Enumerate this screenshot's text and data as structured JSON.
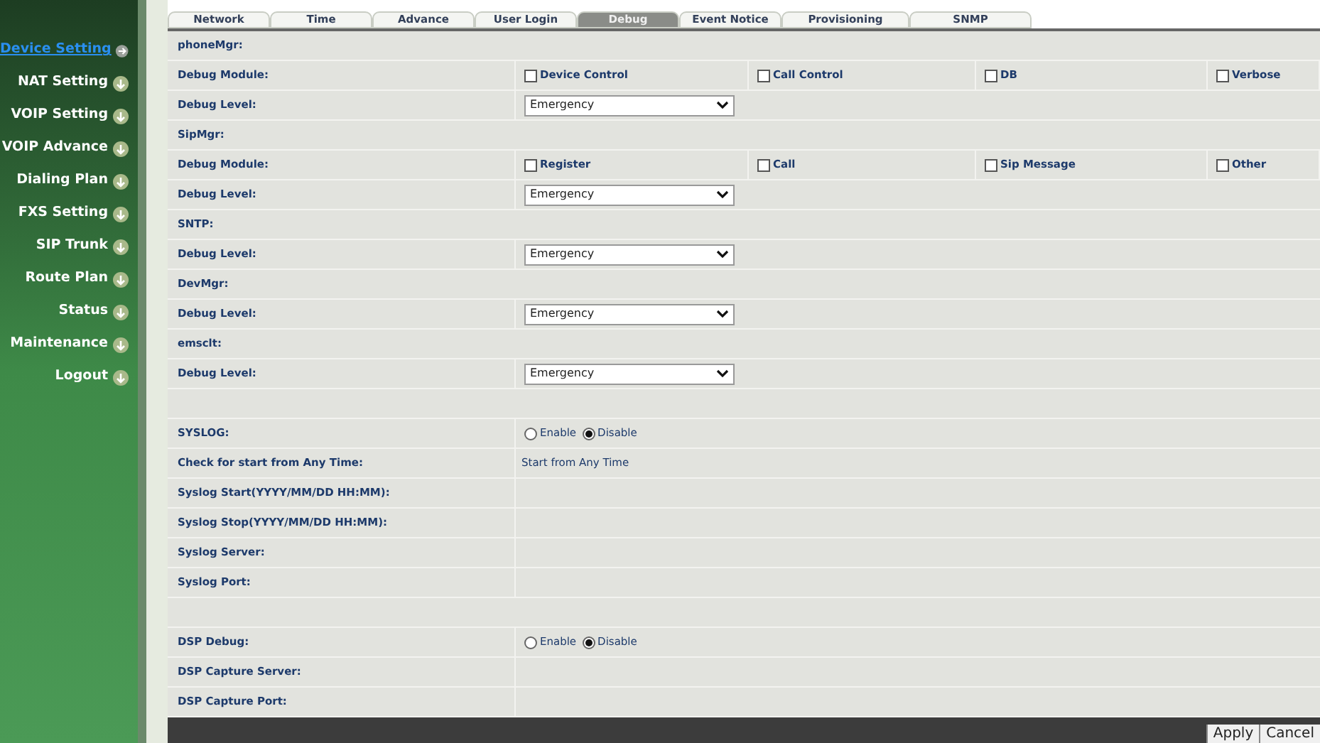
{
  "sidebar": {
    "items": [
      {
        "label": "Device Setting",
        "selected": true
      },
      {
        "label": "NAT Setting",
        "selected": false
      },
      {
        "label": "VOIP Setting",
        "selected": false
      },
      {
        "label": "VOIP Advance",
        "selected": false
      },
      {
        "label": "Dialing Plan",
        "selected": false
      },
      {
        "label": "FXS Setting",
        "selected": false
      },
      {
        "label": "SIP Trunk",
        "selected": false
      },
      {
        "label": "Route Plan",
        "selected": false
      },
      {
        "label": "Status",
        "selected": false
      },
      {
        "label": "Maintenance",
        "selected": false
      },
      {
        "label": "Logout",
        "selected": false
      }
    ]
  },
  "tabs": [
    {
      "label": "Network",
      "selected": false
    },
    {
      "label": "Time",
      "selected": false
    },
    {
      "label": "Advance",
      "selected": false
    },
    {
      "label": "User Login",
      "selected": false
    },
    {
      "label": "Debug",
      "selected": true
    },
    {
      "label": "Event Notice",
      "selected": false
    },
    {
      "label": "Provisioning",
      "selected": false
    },
    {
      "label": "SNMP",
      "selected": false
    }
  ],
  "rows": [
    {
      "kind": "heading",
      "label": "phoneMgr:"
    },
    {
      "kind": "checkboxes",
      "label": "Debug Module:",
      "options": [
        {
          "label": "Device Control",
          "checked": false
        },
        {
          "label": "Call Control",
          "checked": false
        },
        {
          "label": "DB",
          "checked": false
        },
        {
          "label": "Verbose",
          "checked": false
        }
      ]
    },
    {
      "kind": "select",
      "label": "Debug Level:",
      "value": "Emergency"
    },
    {
      "kind": "heading",
      "label": "SipMgr:"
    },
    {
      "kind": "checkboxes",
      "label": "Debug Module:",
      "options": [
        {
          "label": "Register",
          "checked": false
        },
        {
          "label": "Call",
          "checked": false
        },
        {
          "label": "Sip Message",
          "checked": false
        },
        {
          "label": "Other",
          "checked": false
        }
      ]
    },
    {
      "kind": "select",
      "label": "Debug Level:",
      "value": "Emergency"
    },
    {
      "kind": "heading",
      "label": "SNTP:"
    },
    {
      "kind": "select",
      "label": "Debug Level:",
      "value": "Emergency"
    },
    {
      "kind": "heading",
      "label": "DevMgr:"
    },
    {
      "kind": "select",
      "label": "Debug Level:",
      "value": "Emergency"
    },
    {
      "kind": "heading",
      "label": "emsclt:"
    },
    {
      "kind": "select",
      "label": "Debug Level:",
      "value": "Emergency"
    },
    {
      "kind": "spacer"
    },
    {
      "kind": "radio",
      "label": "SYSLOG:",
      "options": [
        {
          "label": "Enable",
          "selected": false
        },
        {
          "label": "Disable",
          "selected": true
        }
      ]
    },
    {
      "kind": "text",
      "label": "Check for start from Any Time:",
      "value": "Start from Any Time"
    },
    {
      "kind": "field",
      "label": "Syslog Start(YYYY/MM/DD HH:MM):"
    },
    {
      "kind": "field",
      "label": "Syslog Stop(YYYY/MM/DD HH:MM):"
    },
    {
      "kind": "field",
      "label": "Syslog Server:"
    },
    {
      "kind": "field",
      "label": "Syslog Port:"
    },
    {
      "kind": "spacer"
    },
    {
      "kind": "radio",
      "label": "DSP Debug:",
      "options": [
        {
          "label": "Enable",
          "selected": false
        },
        {
          "label": "Disable",
          "selected": true
        }
      ]
    },
    {
      "kind": "field",
      "label": "DSP Capture Server:"
    },
    {
      "kind": "field",
      "label": "DSP Capture Port:"
    }
  ],
  "buttons": [
    "Apply",
    "Cancel"
  ]
}
